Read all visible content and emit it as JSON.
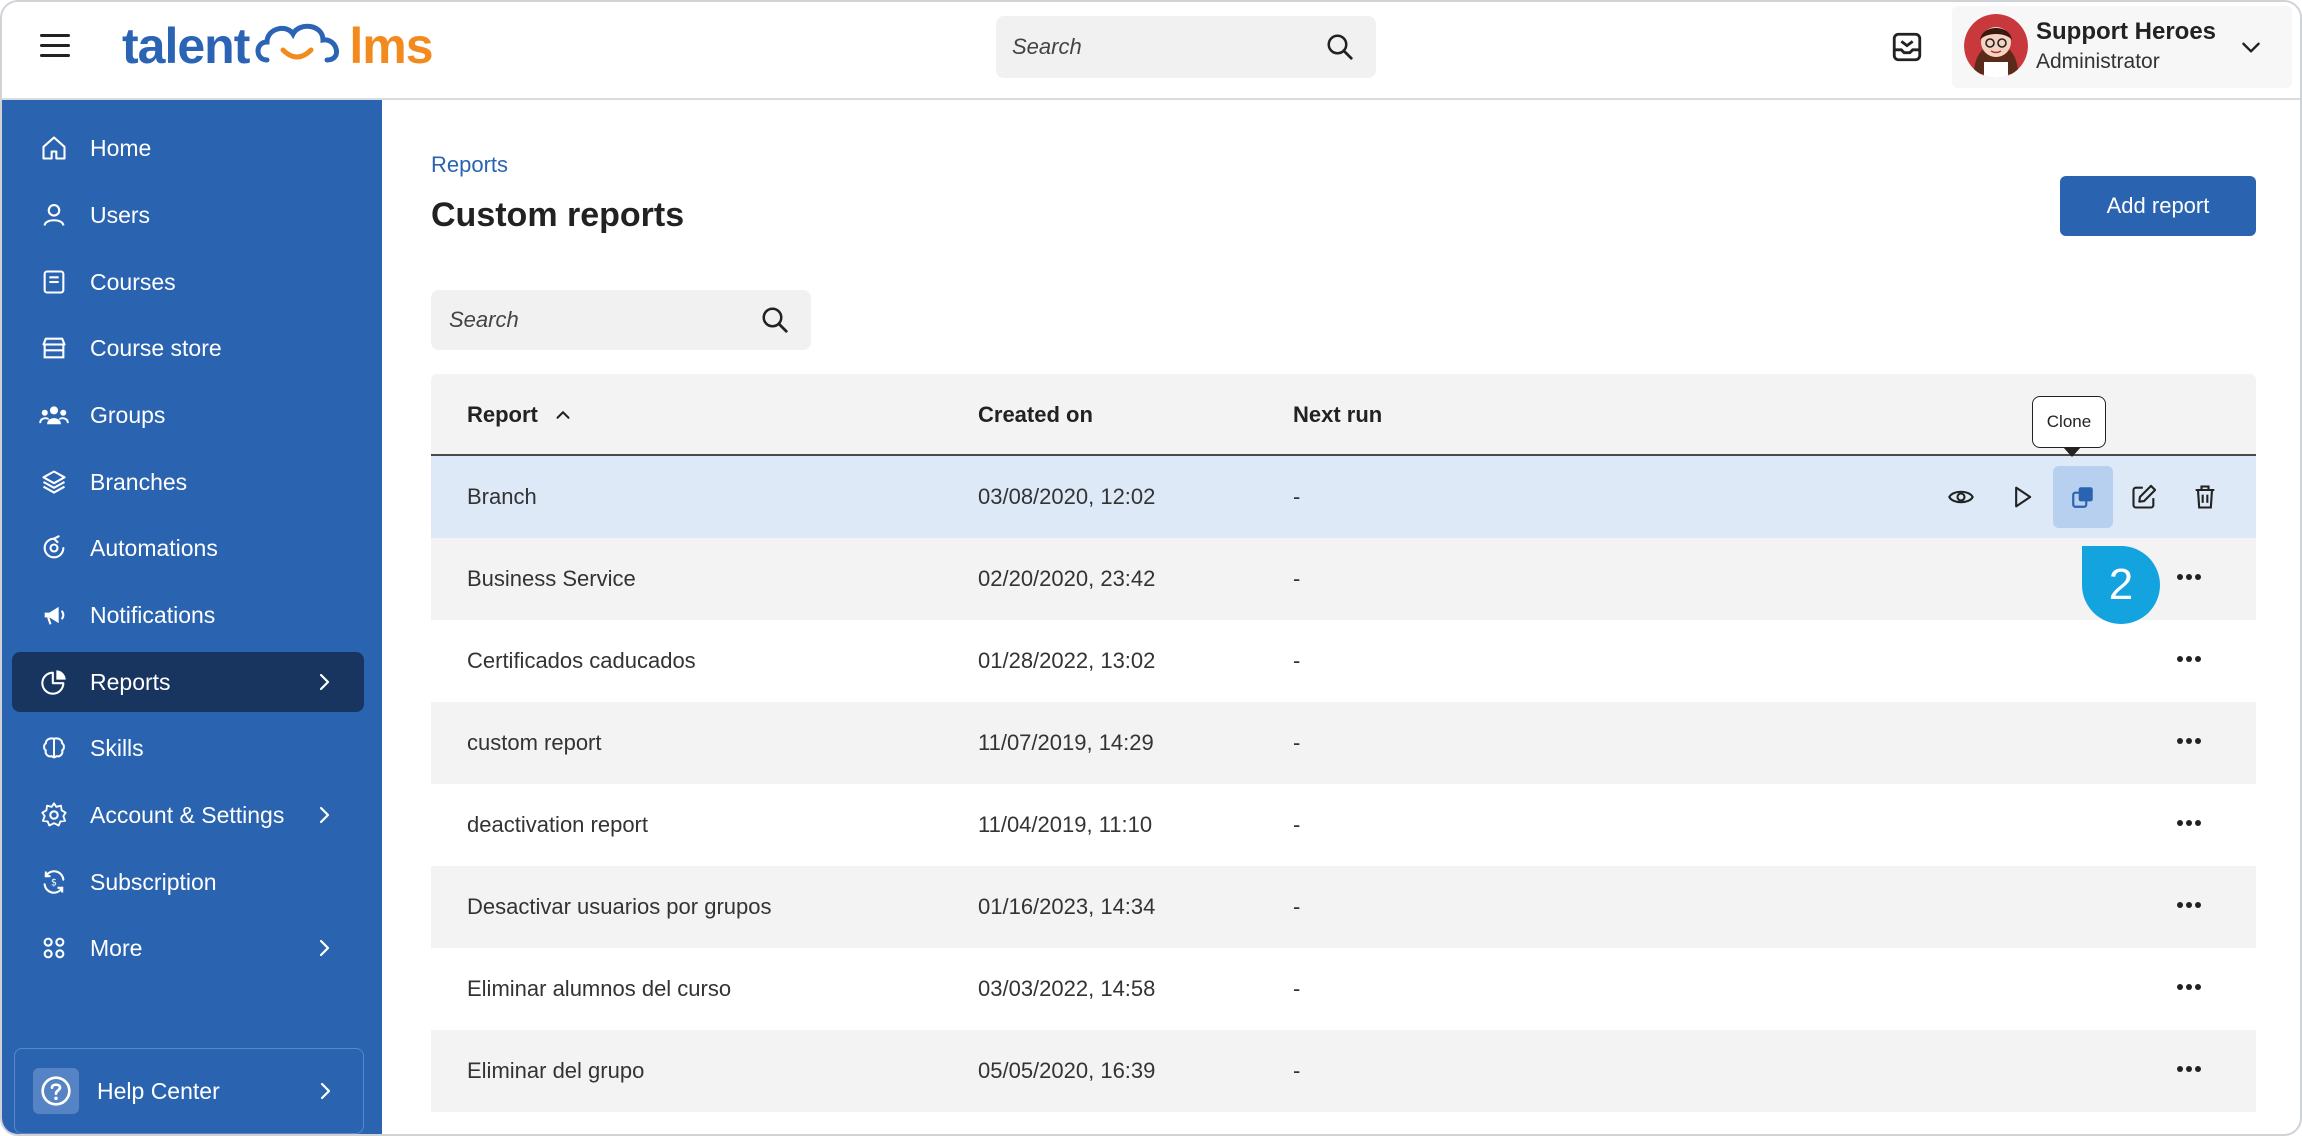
{
  "app": {
    "logo_left": "talent",
    "logo_right": "lms"
  },
  "header": {
    "search_placeholder": "Search",
    "user_name": "Support Heroes",
    "user_role": "Administrator"
  },
  "sidebar": {
    "items": [
      {
        "label": "Home",
        "icon": "home-icon"
      },
      {
        "label": "Users",
        "icon": "user-icon"
      },
      {
        "label": "Courses",
        "icon": "book-icon"
      },
      {
        "label": "Course store",
        "icon": "store-icon"
      },
      {
        "label": "Groups",
        "icon": "groups-icon"
      },
      {
        "label": "Branches",
        "icon": "layers-icon"
      },
      {
        "label": "Automations",
        "icon": "automation-icon"
      },
      {
        "label": "Notifications",
        "icon": "megaphone-icon"
      },
      {
        "label": "Reports",
        "icon": "pie-chart-icon",
        "active": true
      },
      {
        "label": "Skills",
        "icon": "brain-icon"
      },
      {
        "label": "Account & Settings",
        "icon": "gear-icon"
      },
      {
        "label": "Subscription",
        "icon": "refresh-icon"
      },
      {
        "label": "More",
        "icon": "grid-icon"
      }
    ],
    "help_center": "Help Center"
  },
  "main": {
    "breadcrumb": "Reports",
    "title": "Custom reports",
    "add_button": "Add report",
    "search_placeholder": "Search",
    "table": {
      "headers": {
        "report": "Report",
        "created_on": "Created on",
        "next_run": "Next run"
      },
      "rows": [
        {
          "report": "Branch",
          "created_on": "03/08/2020, 12:02",
          "next_run": "-"
        },
        {
          "report": "Business Service",
          "created_on": "02/20/2020, 23:42",
          "next_run": "-"
        },
        {
          "report": "Certificados caducados",
          "created_on": "01/28/2022, 13:02",
          "next_run": "-"
        },
        {
          "report": "custom report",
          "created_on": "11/07/2019, 14:29",
          "next_run": "-"
        },
        {
          "report": "deactivation report",
          "created_on": "11/04/2019, 11:10",
          "next_run": "-"
        },
        {
          "report": "Desactivar usuarios por grupos",
          "created_on": "01/16/2023, 14:34",
          "next_run": "-"
        },
        {
          "report": "Eliminar alumnos del curso",
          "created_on": "03/03/2022, 14:58",
          "next_run": "-"
        },
        {
          "report": "Eliminar del grupo",
          "created_on": "05/05/2020, 16:39",
          "next_run": "-"
        }
      ]
    },
    "tooltip": "Clone",
    "step_number": "2"
  },
  "colors": {
    "brand_blue": "#2a63b0",
    "brand_orange": "#f28a1e",
    "active_nav": "#17355f",
    "highlight_row": "#dde9f7",
    "step_marker": "#13a4e0"
  }
}
